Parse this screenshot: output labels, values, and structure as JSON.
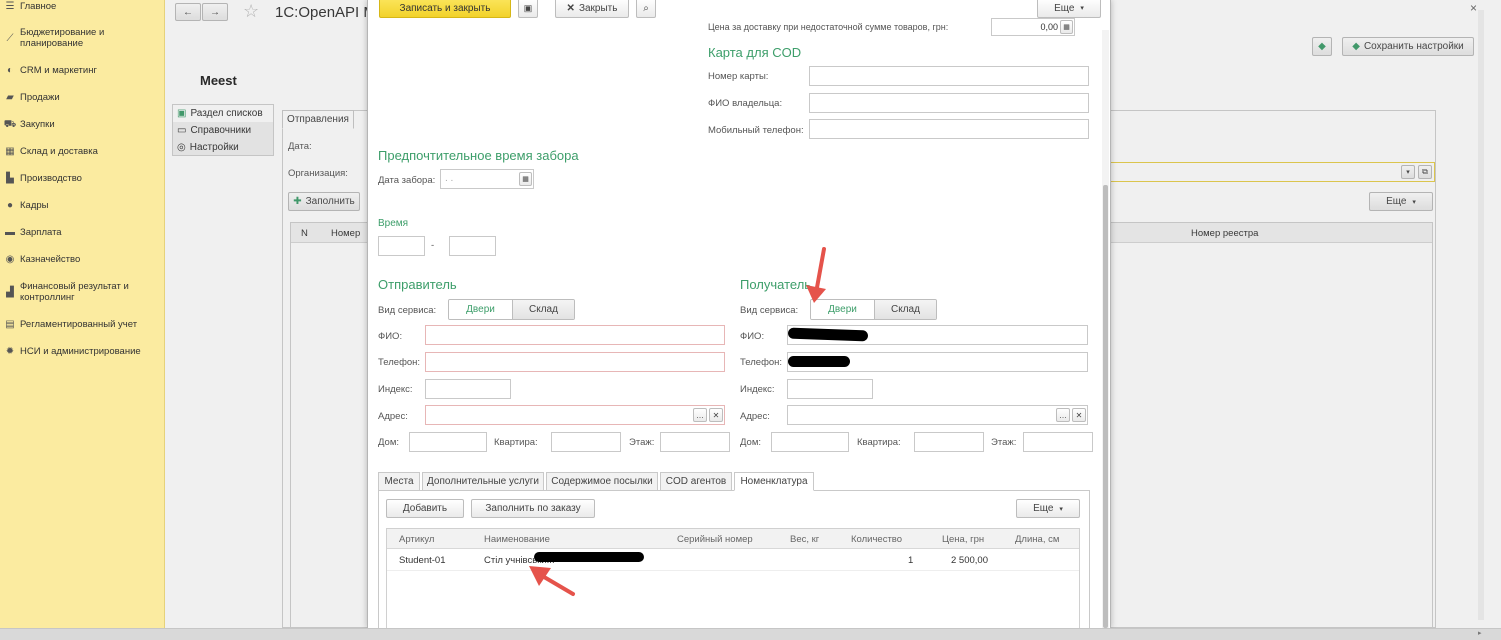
{
  "sidebar": {
    "items": [
      {
        "icon": "menu-icon",
        "label": "Главное"
      },
      {
        "icon": "chart-line-icon",
        "label": "Бюджетирование и планирование"
      },
      {
        "icon": "crm-icon",
        "label": "CRM и маркетинг"
      },
      {
        "icon": "bag-icon",
        "label": "Продажи"
      },
      {
        "icon": "cart-icon",
        "label": "Закупки"
      },
      {
        "icon": "warehouse-icon",
        "label": "Склад и доставка"
      },
      {
        "icon": "factory-icon",
        "label": "Производство"
      },
      {
        "icon": "person-icon",
        "label": "Кадры"
      },
      {
        "icon": "wallet-icon",
        "label": "Зарплата"
      },
      {
        "icon": "treasury-icon",
        "label": "Казначейство"
      },
      {
        "icon": "chart-bar-icon",
        "label": "Финансовый результат и контроллинг"
      },
      {
        "icon": "doc-icon",
        "label": "Регламентированный учет"
      },
      {
        "icon": "gear-icon",
        "label": "НСИ и администрирование"
      }
    ]
  },
  "app": {
    "title": "1С:OpenAPI M",
    "logo": "Meest",
    "save_settings": "Сохранить настройки",
    "left_panel": [
      "Раздел списков",
      "Справочники",
      "Настройки"
    ],
    "tabs": [
      "Отправления"
    ],
    "date_label": "Дата:",
    "org_label": "Организация:",
    "fill_button": "Заполнить",
    "more_button": "Еще",
    "table_headers": [
      "N",
      "Номер",
      "Номер реестра"
    ]
  },
  "modal": {
    "toolbar": {
      "save_close": "Записать и закрыть",
      "close": "Закрыть",
      "more": "Еще"
    },
    "delivery_price_label": "Цена за доставку при недостаточной сумме товаров, грн:",
    "delivery_price_value": "0,00",
    "cod": {
      "title": "Карта для COD",
      "card_label": "Номер карты:",
      "owner_label": "ФИО владельца:",
      "phone_label": "Мобильный телефон:"
    },
    "pickup": {
      "title": "Предпочтительное время забора",
      "date_label": "Дата забора:",
      "date_value": ". .",
      "time_label": "Время",
      "time_sep": "-"
    },
    "sender": {
      "title": "Отправитель",
      "service_label": "Вид сервиса:",
      "opt1": "Двери",
      "opt2": "Склад",
      "name_label": "ФИО:",
      "phone_label": "Телефон:",
      "index_label": "Индекс:",
      "address_label": "Адрес:",
      "house_label": "Дом:",
      "flat_label": "Квартира:",
      "floor_label": "Этаж:"
    },
    "receiver": {
      "title": "Получатель",
      "service_label": "Вид сервиса:",
      "opt1": "Двери",
      "opt2": "Склад",
      "name_label": "ФИО:",
      "phone_label": "Телефон:",
      "index_label": "Индекс:",
      "address_label": "Адрес:",
      "house_label": "Дом:",
      "flat_label": "Квартира:",
      "floor_label": "Этаж:"
    },
    "tabs": [
      "Места",
      "Дополнительные услуги",
      "Содержимое посылки",
      "COD агентов",
      "Номенклатура"
    ],
    "goods": {
      "add_button": "Добавить",
      "fill_by_order": "Заполнить по заказу",
      "more": "Еще",
      "headers": [
        "Артикул",
        "Наименование",
        "Серийный номер",
        "Вес, кг",
        "Количество",
        "Цена, грн",
        "Длина, см"
      ],
      "rows": [
        {
          "article": "Student-01",
          "name": "Стіл учнівськи...",
          "serial": "",
          "weight": "",
          "qty": "1",
          "price": "2 500,00",
          "length": ""
        }
      ]
    }
  },
  "colors": {
    "sidebar": "#fbeba0",
    "accent_green": "#3d9e6a",
    "yellow_button": "#f5d93b",
    "arrow_red": "#e5534b"
  }
}
